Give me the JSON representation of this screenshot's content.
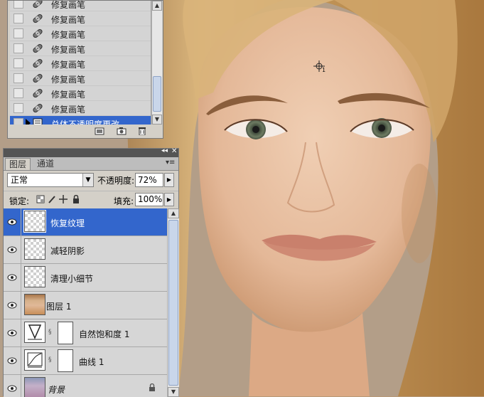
{
  "history": {
    "items": [
      {
        "label": "修复画笔",
        "icon": "healing-brush-icon"
      },
      {
        "label": "修复画笔",
        "icon": "healing-brush-icon"
      },
      {
        "label": "修复画笔",
        "icon": "healing-brush-icon"
      },
      {
        "label": "修复画笔",
        "icon": "healing-brush-icon"
      },
      {
        "label": "修复画笔",
        "icon": "healing-brush-icon"
      },
      {
        "label": "修复画笔",
        "icon": "healing-brush-icon"
      },
      {
        "label": "修复画笔",
        "icon": "healing-brush-icon"
      },
      {
        "label": "修复画笔",
        "icon": "healing-brush-icon"
      },
      {
        "label": "总体不透明度更改",
        "icon": "history-state-icon",
        "selected": true
      }
    ],
    "footer_icons": [
      "new-document-from-state-icon",
      "new-snapshot-icon",
      "delete-state-icon"
    ]
  },
  "cursor": {
    "badge": "1"
  },
  "layers_panel": {
    "tabs": [
      {
        "label": "图层",
        "active": true
      },
      {
        "label": "通道",
        "active": false
      }
    ],
    "blend_mode": "正常",
    "opacity_label": "不透明度:",
    "opacity_value": "72%",
    "lock_label": "锁定:",
    "fill_label": "填充:",
    "fill_value": "100%",
    "layers": [
      {
        "name": "恢复纹理",
        "thumb": "transparent",
        "selected": true,
        "visible": true
      },
      {
        "name": "减轻阴影",
        "thumb": "transparent",
        "selected": false,
        "visible": true
      },
      {
        "name": "清理小细节",
        "thumb": "transparent",
        "selected": false,
        "visible": true
      },
      {
        "name": "图层 1",
        "thumb": "photo",
        "selected": false,
        "visible": true
      },
      {
        "name": "自然饱和度 1",
        "thumb": "vibrance-adjustment",
        "selected": false,
        "visible": true,
        "has_mask": true
      },
      {
        "name": "曲线 1",
        "thumb": "curves-adjustment",
        "selected": false,
        "visible": true,
        "has_mask": true
      },
      {
        "name": "背景",
        "thumb": "photo",
        "selected": false,
        "visible": true,
        "locked": true,
        "italic": true
      }
    ]
  },
  "colors": {
    "selection": "#3366cc",
    "panel_bg": "#d4d0c8"
  }
}
